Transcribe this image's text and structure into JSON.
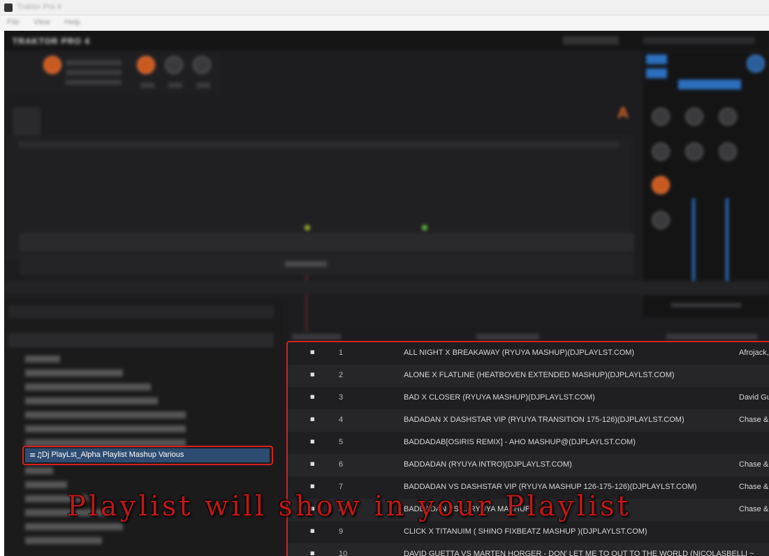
{
  "window": {
    "title": "Traktor Pro 4",
    "menu": [
      "File",
      "View",
      "Help"
    ]
  },
  "brand": "TRAKTOR PRO 4",
  "deck_letter": "A",
  "accent_colors": {
    "orange": "#e06a2a",
    "blue": "#2c6fbf",
    "highlight_red": "#d62020",
    "selection": "#2e4c72"
  },
  "playlist_tree": {
    "selected_item": {
      "icon": "playlist-icon",
      "label": "Dj PlayLst_Alpha Playlist Mashup Various"
    }
  },
  "tracks": [
    {
      "num": "1",
      "title": "ALL NIGHT X BREAKAWAY (RYUYA MASHUP)(DJPLAYLST.COM)",
      "artist": "Afrojack,"
    },
    {
      "num": "2",
      "title": "ALONE X FLATLINE (HEATBOVEN EXTENDED MASHUP)(DJPLAYLST.COM)",
      "artist": ""
    },
    {
      "num": "3",
      "title": "BAD X CLOSER (RYUYA MASHUP)(DJPLAYLST.COM)",
      "artist": "David Gu"
    },
    {
      "num": "4",
      "title": "BADADAN X DASHSTAR VIP (RYUYA TRANSITION 175-126)(DJPLAYLST.COM)",
      "artist": "Chase & S"
    },
    {
      "num": "5",
      "title": "BADDADAB[OSIRIS REMIX] - AHO MASHUP@(DJPLAYLST.COM)",
      "artist": ""
    },
    {
      "num": "6",
      "title": "BADDADAN (RYUYA INTRO)(DJPLAYLST.COM)",
      "artist": "Chase & S"
    },
    {
      "num": "7",
      "title": "BADDADAN VS DASHSTAR VIP (RYUYA MASHUP 126-175-126)(DJPLAYLST.COM)",
      "artist": "Chase & S"
    },
    {
      "num": "8",
      "title": "BADDADAN VS ...(RYUYA MASHUP",
      "artist": "Chase & S"
    },
    {
      "num": "9",
      "title": "CLICK X TITANUIM ( SHINO FIXBEATZ MASHUP )(DJPLAYLST.COM)",
      "artist": ""
    },
    {
      "num": "10",
      "title": "DAVID GUETTA VS MARTEN HORGER - DON' LET ME TO OUT TO THE WORLD (NICOLASBELLI ~",
      "artist": ""
    }
  ],
  "caption": "Playlist will show in your Playlist"
}
